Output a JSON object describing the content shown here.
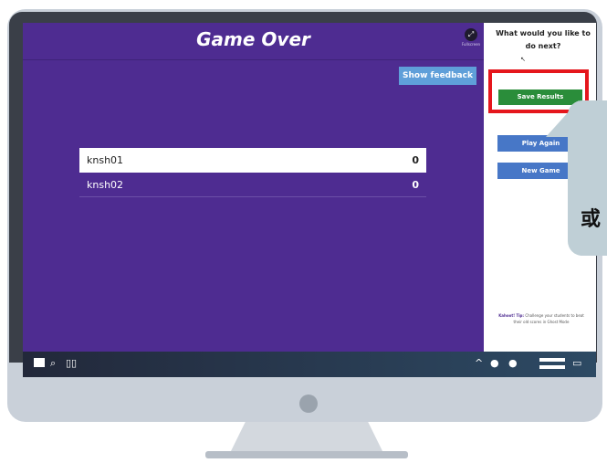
{
  "game": {
    "title": "Game Over",
    "fullscreen_label": "Fullscreen",
    "feedback_button": "Show feedback",
    "scores": [
      {
        "name": "knsh01",
        "score": "0"
      },
      {
        "name": "knsh02",
        "score": "0"
      }
    ]
  },
  "sidebar": {
    "question": "What would you like to do next?",
    "save_button": "Save Results",
    "play_again_button": "Play Again",
    "new_game_button": "New Game",
    "tip_label": "Kahoot! Tip:",
    "tip_text": "Challenge your students to beat their old scores in Ghost Mode"
  },
  "callout": {
    "text": "或"
  },
  "colors": {
    "game_bg": "#4e2c91",
    "save_green": "#2a8d3a",
    "action_blue": "#4777c7",
    "feedback_blue": "#5f9fd9",
    "highlight_red": "#e5161c"
  },
  "taskbar": {
    "left_icons": [
      "windows-icon",
      "search-icon",
      "task-view-icon"
    ],
    "right_icons": [
      "chevron-up-icon",
      "circle-icon",
      "circle-icon",
      "menu-icon",
      "chat-icon"
    ]
  }
}
